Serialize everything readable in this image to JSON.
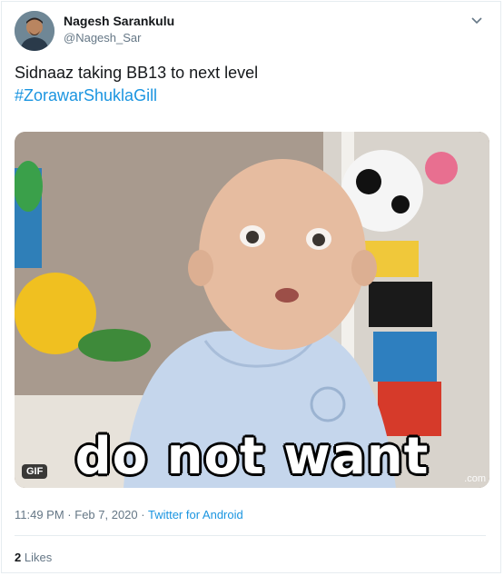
{
  "user": {
    "name": "Nagesh Sarankulu",
    "handle": "@Nagesh_Sar"
  },
  "tweet": {
    "text_line1": "Sidnaaz taking BB13 to next level",
    "hashtag": "#ZorawarShuklaGill"
  },
  "media": {
    "type_badge": "GIF",
    "caption": "do not want",
    "watermark": ".com"
  },
  "meta": {
    "time": "11:49 PM",
    "separator": " · ",
    "date": "Feb 7, 2020",
    "source": "Twitter for Android"
  },
  "engagement": {
    "likes_count": "2",
    "likes_label": "Likes"
  },
  "icons": {
    "more": "chevron-down-icon"
  }
}
